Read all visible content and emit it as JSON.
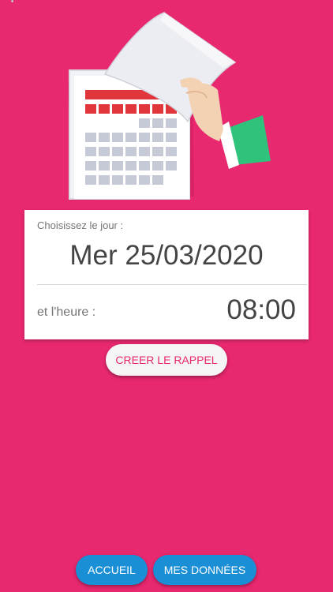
{
  "colors": {
    "background": "#E8286F",
    "card": "#FFFFFF",
    "accent_text": "#E8286F",
    "nav_button": "#1A8FD6",
    "calendar_red": "#E0363C",
    "calendar_grid": "#C6C9D6",
    "cuff_green": "#2FC27A"
  },
  "illustration": {
    "icon": "calendar-page-tear-icon"
  },
  "form": {
    "day_label": "Choisissez le jour :",
    "date_value": "Mer 25/03/2020",
    "time_label": "et l'heure :",
    "time_value": "08:00"
  },
  "actions": {
    "create_label": "CREER LE RAPPEL"
  },
  "nav": {
    "home_label": "ACCUEIL",
    "data_label": "MES DONNÉES"
  }
}
